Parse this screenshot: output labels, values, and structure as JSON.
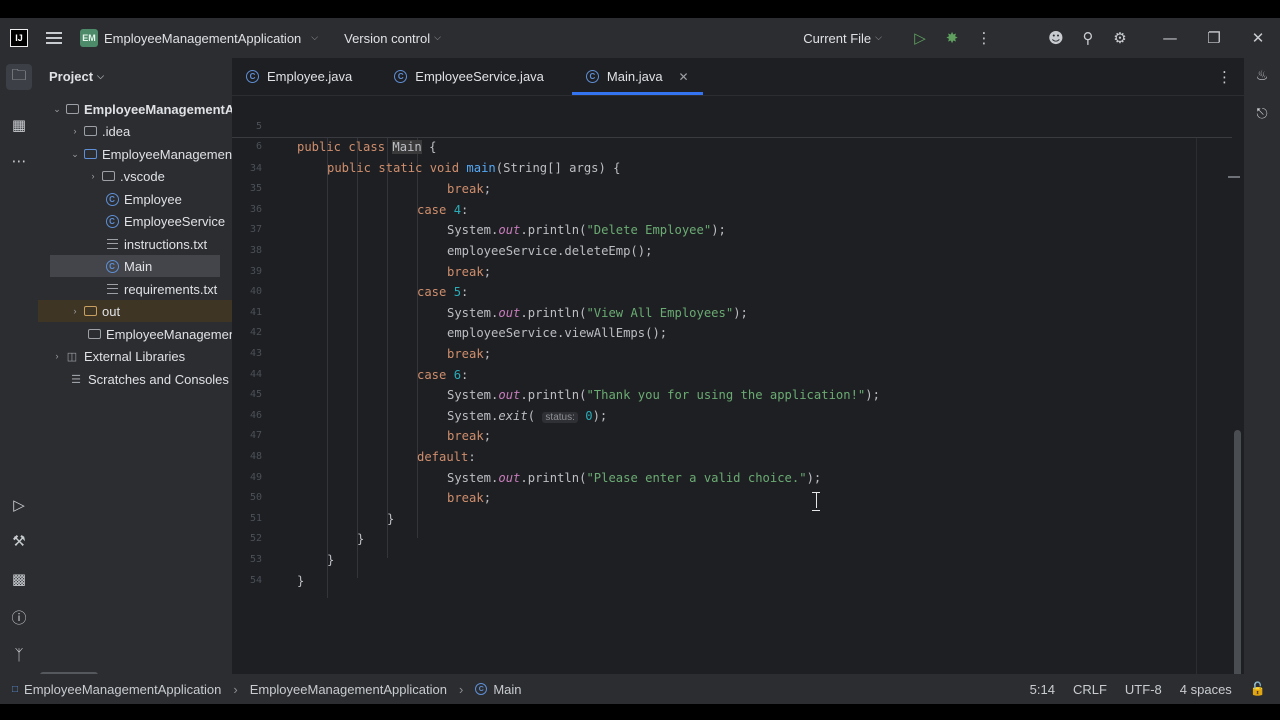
{
  "titlebar": {
    "logo": "IJ",
    "project_badge": "EM",
    "project_name": "EmployeeManagementApplication",
    "version_control": "Version control",
    "run_config": "Current File"
  },
  "project_panel": {
    "title": "Project",
    "rows": [
      {
        "label": "EmployeeManagementApplication"
      },
      {
        "label": ".idea"
      },
      {
        "label": "EmployeeManagementApplication"
      },
      {
        "label": ".vscode"
      },
      {
        "label": "Employee"
      },
      {
        "label": "EmployeeService"
      },
      {
        "label": "instructions.txt"
      },
      {
        "label": "Main"
      },
      {
        "label": "requirements.txt"
      },
      {
        "label": "out"
      },
      {
        "label": "EmployeeManagementApplication.iml"
      },
      {
        "label": "External Libraries"
      },
      {
        "label": "Scratches and Consoles"
      }
    ]
  },
  "tabs": [
    {
      "label": "Employee.java"
    },
    {
      "label": "EmployeeService.java"
    },
    {
      "label": "Main.java"
    }
  ],
  "code": {
    "sticky": [
      {
        "ln": "5",
        "text": "public class Main {"
      },
      {
        "ln": "6",
        "text": "public static void main(String[] args) {"
      }
    ],
    "lines": [
      {
        "ln": "34",
        "text": "break;"
      },
      {
        "ln": "35",
        "text": "case 4:"
      },
      {
        "ln": "36",
        "text": "System.out.println(\"Delete Employee\");"
      },
      {
        "ln": "37",
        "text": "employeeService.deleteEmp();"
      },
      {
        "ln": "38",
        "text": "break;"
      },
      {
        "ln": "39",
        "text": "case 5:"
      },
      {
        "ln": "40",
        "text": "System.out.println(\"View All Employees\");"
      },
      {
        "ln": "41",
        "text": "employeeService.viewAllEmps();"
      },
      {
        "ln": "42",
        "text": "break;"
      },
      {
        "ln": "43",
        "text": "case 6:"
      },
      {
        "ln": "44",
        "text": "System.out.println(\"Thank you for using the application!\");"
      },
      {
        "ln": "45",
        "text": "System.exit( status: 0);"
      },
      {
        "ln": "46",
        "text": "break;"
      },
      {
        "ln": "47",
        "text": "default:"
      },
      {
        "ln": "48",
        "text": "System.out.println(\"Please enter a valid choice.\");"
      },
      {
        "ln": "49",
        "text": "break;"
      },
      {
        "ln": "50",
        "text": "}"
      },
      {
        "ln": "51",
        "text": "}"
      },
      {
        "ln": "52",
        "text": "}"
      },
      {
        "ln": "53",
        "text": "}"
      },
      {
        "ln": "54",
        "text": ""
      }
    ]
  },
  "statusbar": {
    "crumbs": [
      "EmployeeManagementApplication",
      "EmployeeManagementApplication",
      "Main"
    ],
    "position": "5:14",
    "line_sep": "CRLF",
    "encoding": "UTF-8",
    "indent": "4 spaces"
  },
  "colors": {
    "accent": "#3574f0",
    "keyword": "#cf8e6d",
    "string": "#6aab73",
    "number": "#2aacb8",
    "function": "#56a8f5",
    "static_field": "#c77dbb"
  }
}
